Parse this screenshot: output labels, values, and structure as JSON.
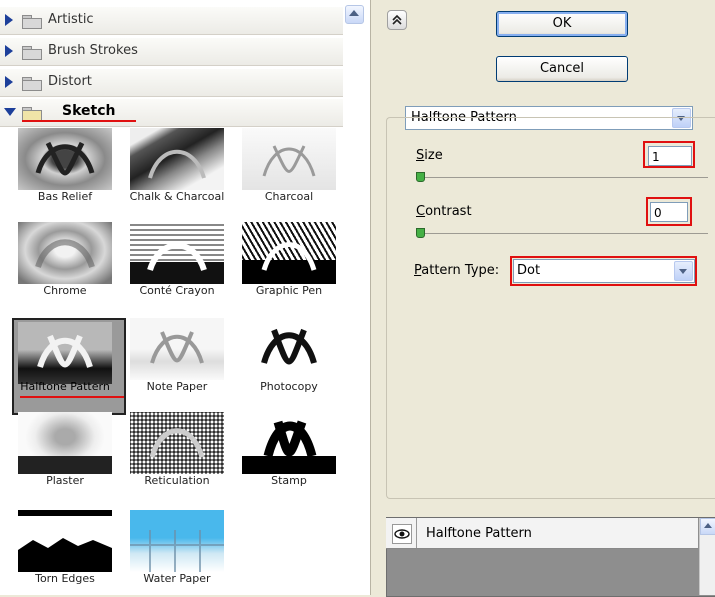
{
  "categories": [
    {
      "label": "Artistic",
      "expanded": false
    },
    {
      "label": "Brush Strokes",
      "expanded": false
    },
    {
      "label": "Distort",
      "expanded": false
    },
    {
      "label": "Sketch",
      "expanded": true
    }
  ],
  "filters": [
    {
      "label": "Bas Relief"
    },
    {
      "label": "Chalk & Charcoal"
    },
    {
      "label": "Charcoal"
    },
    {
      "label": "Chrome"
    },
    {
      "label": "Conté Crayon"
    },
    {
      "label": "Graphic Pen"
    },
    {
      "label": "Halftone Pattern",
      "selected": true
    },
    {
      "label": "Note Paper"
    },
    {
      "label": "Photocopy"
    },
    {
      "label": "Plaster"
    },
    {
      "label": "Reticulation"
    },
    {
      "label": "Stamp"
    },
    {
      "label": "Torn Edges"
    },
    {
      "label": "Water Paper"
    }
  ],
  "buttons": {
    "ok": "OK",
    "cancel": "Cancel"
  },
  "filter_select": {
    "value": "Halftone Pattern"
  },
  "size": {
    "label_key": "S",
    "label_rest": "ize",
    "value": "1"
  },
  "contrast": {
    "label_key": "C",
    "label_rest": "ontrast",
    "value": "0"
  },
  "pattern_type": {
    "label_key": "P",
    "label_rest": "attern Type:",
    "value": "Dot"
  },
  "layers": {
    "item": "Halftone Pattern"
  },
  "colors": {
    "highlight": "#e01010",
    "selection_border": "#222222"
  }
}
